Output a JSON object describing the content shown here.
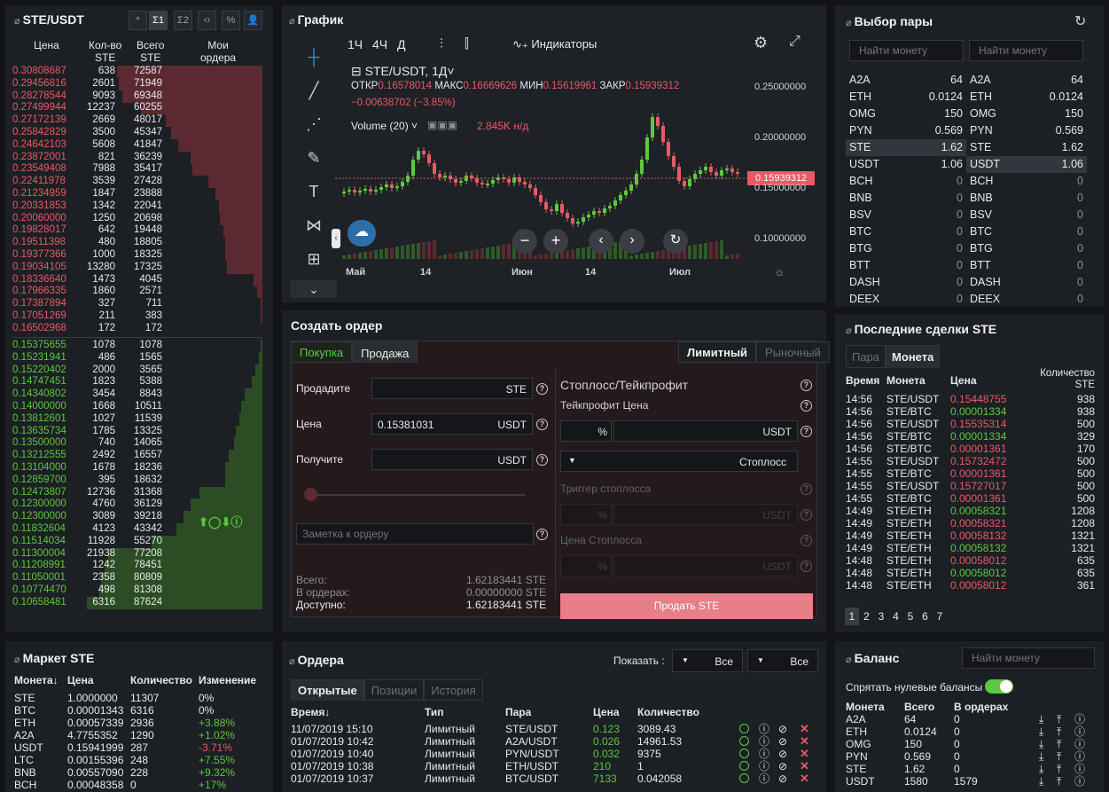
{
  "orderbook": {
    "title": "STE/USDT",
    "toolbar": [
      "*",
      "Σ1",
      "Σ2",
      "‹›",
      "%",
      "👤"
    ],
    "headers": {
      "price": "Цена",
      "qty": "Кол-во\nSTE",
      "total": "Всего\nSTE",
      "my": "Мои\nордера"
    },
    "asks": [
      [
        "0.30808687",
        "638",
        "72587"
      ],
      [
        "0.29456816",
        "2601",
        "71949"
      ],
      [
        "0.28278544",
        "9093",
        "69348"
      ],
      [
        "0.27499944",
        "12237",
        "60255"
      ],
      [
        "0.27172139",
        "2669",
        "48017"
      ],
      [
        "0.25842829",
        "3500",
        "45347"
      ],
      [
        "0.24642103",
        "5608",
        "41847"
      ],
      [
        "0.23872001",
        "821",
        "36239"
      ],
      [
        "0.23549408",
        "7988",
        "35417"
      ],
      [
        "0.22411978",
        "3539",
        "27428"
      ],
      [
        "0.21234959",
        "1847",
        "23888"
      ],
      [
        "0.20331853",
        "1342",
        "22041"
      ],
      [
        "0.20060000",
        "1250",
        "20698"
      ],
      [
        "0.19828017",
        "642",
        "19448"
      ],
      [
        "0.19511398",
        "480",
        "18805"
      ],
      [
        "0.19377366",
        "1000",
        "18325"
      ],
      [
        "0.19034105",
        "13280",
        "17325"
      ],
      [
        "0.18336640",
        "1473",
        "4045"
      ],
      [
        "0.17966335",
        "1860",
        "2571"
      ],
      [
        "0.17387894",
        "327",
        "711"
      ],
      [
        "0.17051269",
        "211",
        "383"
      ],
      [
        "0.16502968",
        "172",
        "172"
      ]
    ],
    "bids": [
      [
        "0.15375655",
        "1078",
        "1078"
      ],
      [
        "0.15231941",
        "486",
        "1565"
      ],
      [
        "0.15220402",
        "2000",
        "3565"
      ],
      [
        "0.14747451",
        "1823",
        "5388"
      ],
      [
        "0.14340802",
        "3454",
        "8843"
      ],
      [
        "0.14000000",
        "1668",
        "10511"
      ],
      [
        "0.13812601",
        "1027",
        "11539"
      ],
      [
        "0.13635734",
        "1785",
        "13325"
      ],
      [
        "0.13500000",
        "740",
        "14065"
      ],
      [
        "0.13212555",
        "2492",
        "16557"
      ],
      [
        "0.13104000",
        "1678",
        "18236"
      ],
      [
        "0.12859700",
        "395",
        "18632"
      ],
      [
        "0.12473807",
        "12736",
        "31368"
      ],
      [
        "0.12300000",
        "4760",
        "36129"
      ],
      [
        "0.12300000",
        "3089",
        "39218"
      ],
      [
        "0.11832604",
        "4123",
        "43342"
      ],
      [
        "0.11514034",
        "11928",
        "55270"
      ],
      [
        "0.11300004",
        "21938",
        "77208"
      ],
      [
        "0.11208991",
        "1242",
        "78451"
      ],
      [
        "0.11050001",
        "2358",
        "80809"
      ],
      [
        "0.10774470",
        "498",
        "81308"
      ],
      [
        "0.10658481",
        "6316",
        "87624"
      ]
    ],
    "depth_ask": [
      0.83,
      0.82,
      0.8,
      0.69,
      0.55,
      0.52,
      0.48,
      0.41,
      0.4,
      0.31,
      0.27,
      0.25,
      0.24,
      0.22,
      0.21,
      0.21,
      0.2,
      0.05,
      0.03,
      0.01,
      0.01,
      0.0
    ],
    "depth_bid": [
      0.01,
      0.02,
      0.04,
      0.06,
      0.1,
      0.12,
      0.13,
      0.15,
      0.16,
      0.19,
      0.21,
      0.21,
      0.36,
      0.41,
      0.45,
      0.49,
      0.63,
      0.88,
      0.9,
      0.92,
      0.93,
      1.0
    ]
  },
  "chart": {
    "title": "График",
    "intervals": [
      "1Ч",
      "4Ч",
      "Д"
    ],
    "indicators_label": "Индикаторы",
    "symbol": "STE/USDT, 1Д",
    "ohlc": {
      "o_label": "ОТКР",
      "o": "0.16578014",
      "h_label": "МАКС",
      "h": "0.16669626",
      "l_label": "МИН",
      "l": "0.15619961",
      "c_label": "ЗАКР",
      "c": "0.15939312"
    },
    "change": "−0.00638702 (−3.85%)",
    "volume_label": "Volume (20)",
    "volume_value": "2.845K н/д",
    "price_tag": "0.15939312",
    "y_ticks": [
      "0.25000000",
      "0.20000000",
      "0.15000000",
      "0.10000000"
    ],
    "x_ticks": [
      "Май",
      "14",
      "Июн",
      "14",
      "Июл"
    ]
  },
  "pairs": {
    "title": "Выбор пары",
    "search1": "Найти монету",
    "search2": "Найти монету",
    "rows": [
      [
        "A2A",
        "64"
      ],
      [
        "ETH",
        "0.0124"
      ],
      [
        "OMG",
        "150"
      ],
      [
        "PYN",
        "0.569"
      ],
      [
        "STE",
        "1.62"
      ],
      [
        "USDT",
        "1.06"
      ],
      [
        "BCH",
        "0"
      ],
      [
        "BNB",
        "0"
      ],
      [
        "BSV",
        "0"
      ],
      [
        "BTC",
        "0"
      ],
      [
        "BTG",
        "0"
      ],
      [
        "BTT",
        "0"
      ],
      [
        "DASH",
        "0"
      ],
      [
        "DEEX",
        "0"
      ]
    ]
  },
  "create_order": {
    "title": "Создать ордер",
    "tabs": [
      "Покупка",
      "Продажа"
    ],
    "type_tabs": [
      "Лимитный",
      "Рыночный"
    ],
    "sell_label": "Продадите",
    "sell_unit": "STE",
    "price_label": "Цена",
    "price_value": "0.15381031",
    "price_unit": "USDT",
    "receive_label": "Получите",
    "receive_unit": "USDT",
    "note_placeholder": "Заметка к ордеру",
    "total_label": "Всего:",
    "total_value": "1.62183441 STE",
    "in_orders_label": "В ордерах:",
    "in_orders_value": "0.00000000 STE",
    "available_label": "Доступно:",
    "available_value": "1.62183441 STE",
    "stop_title": "Стоплосс/Тейкпрофит",
    "tp_label": "Тейкпрофит Цена",
    "pct": "%",
    "usdt": "USDT",
    "stoploss_select": "Стоплосс",
    "trigger_label": "Триггер стоплосса",
    "stop_price_label": "Цена Стоплосса",
    "submit": "Продать STE"
  },
  "trades": {
    "title": "Последние сделки STE",
    "tabs": [
      "Пара",
      "Монета"
    ],
    "headers": {
      "time": "Время",
      "pair": "Монета",
      "price": "Цена",
      "qty": "Количество\nSTE"
    },
    "rows": [
      [
        "14:56",
        "STE/USDT",
        "0.15448755",
        "938",
        "r"
      ],
      [
        "14:56",
        "STE/BTC",
        "0.00001334",
        "938",
        "g"
      ],
      [
        "14:56",
        "STE/USDT",
        "0.15535314",
        "500",
        "r"
      ],
      [
        "14:56",
        "STE/BTC",
        "0.00001334",
        "329",
        "g"
      ],
      [
        "14:56",
        "STE/BTC",
        "0.00001361",
        "170",
        "r"
      ],
      [
        "14:55",
        "STE/USDT",
        "0.15732472",
        "500",
        "r"
      ],
      [
        "14:55",
        "STE/BTC",
        "0.00001361",
        "500",
        "r"
      ],
      [
        "14:55",
        "STE/USDT",
        "0.15727017",
        "500",
        "r"
      ],
      [
        "14:55",
        "STE/BTC",
        "0.00001361",
        "500",
        "r"
      ],
      [
        "14:49",
        "STE/ETH",
        "0.00058321",
        "1208",
        "g"
      ],
      [
        "14:49",
        "STE/ETH",
        "0.00058321",
        "1208",
        "r"
      ],
      [
        "14:49",
        "STE/ETH",
        "0.00058132",
        "1321",
        "r"
      ],
      [
        "14:49",
        "STE/ETH",
        "0.00058132",
        "1321",
        "g"
      ],
      [
        "14:48",
        "STE/ETH",
        "0.00058012",
        "635",
        "r"
      ],
      [
        "14:48",
        "STE/ETH",
        "0.00058012",
        "635",
        "g"
      ],
      [
        "14:48",
        "STE/ETH",
        "0.00058012",
        "361",
        "r"
      ]
    ],
    "pages": [
      "1",
      "2",
      "3",
      "4",
      "5",
      "6",
      "7"
    ]
  },
  "market": {
    "title": "Маркет STE",
    "headers": {
      "coin": "Монета↓",
      "price": "Цена",
      "qty": "Количество",
      "change": "Изменение"
    },
    "rows": [
      [
        "STE",
        "1.0000000",
        "11307",
        "0%",
        "n"
      ],
      [
        "BTC",
        "0.00001343",
        "6316",
        "0%",
        "n"
      ],
      [
        "ETH",
        "0.00057339",
        "2936",
        "+3.88%",
        "g"
      ],
      [
        "A2A",
        "4.7755352",
        "1290",
        "+1.02%",
        "g"
      ],
      [
        "USDT",
        "0.15941999",
        "287",
        "-3.71%",
        "r"
      ],
      [
        "LTC",
        "0.00155396",
        "248",
        "+7.55%",
        "g"
      ],
      [
        "BNB",
        "0.00557090",
        "228",
        "+9.32%",
        "g"
      ],
      [
        "BCH",
        "0.00048358",
        "0",
        "+17%",
        "g"
      ]
    ]
  },
  "orders": {
    "title": "Ордера",
    "show_label": "Показать :",
    "filter1": "Все",
    "filter2": "Все",
    "tabs": [
      "Открытые",
      "Позиции",
      "История"
    ],
    "headers": {
      "time": "Время↓",
      "type": "Тип",
      "pair": "Пара",
      "price": "Цена",
      "qty": "Количество"
    },
    "rows": [
      [
        "11/07/2019 15:10",
        "Лимитный",
        "STE/USDT",
        "0.123",
        "3089.43"
      ],
      [
        "01/07/2019 10:42",
        "Лимитный",
        "A2A/USDT",
        "0.026",
        "14961.53"
      ],
      [
        "01/07/2019 10:40",
        "Лимитный",
        "PYN/USDT",
        "0.032",
        "9375"
      ],
      [
        "01/07/2019 10:38",
        "Лимитный",
        "ETH/USDT",
        "210",
        "1"
      ],
      [
        "01/07/2019 10:37",
        "Лимитный",
        "BTC/USDT",
        "7133",
        "0.042058"
      ]
    ]
  },
  "balance": {
    "title": "Баланс",
    "search": "Найти монету",
    "hide_zero": "Спрятать нулевые балансы",
    "headers": {
      "coin": "Монета",
      "total": "Всего",
      "in_orders": "В ордерах"
    },
    "rows": [
      [
        "A2A",
        "64",
        "0"
      ],
      [
        "ETH",
        "0.0124",
        "0"
      ],
      [
        "OMG",
        "150",
        "0"
      ],
      [
        "PYN",
        "0.569",
        "0"
      ],
      [
        "STE",
        "1.62",
        "0"
      ],
      [
        "USDT",
        "1580",
        "1579"
      ]
    ]
  },
  "colors": {
    "up": "#5cc93f",
    "down": "#e85a66",
    "bg": "#121418",
    "panel": "#1c1f24"
  }
}
